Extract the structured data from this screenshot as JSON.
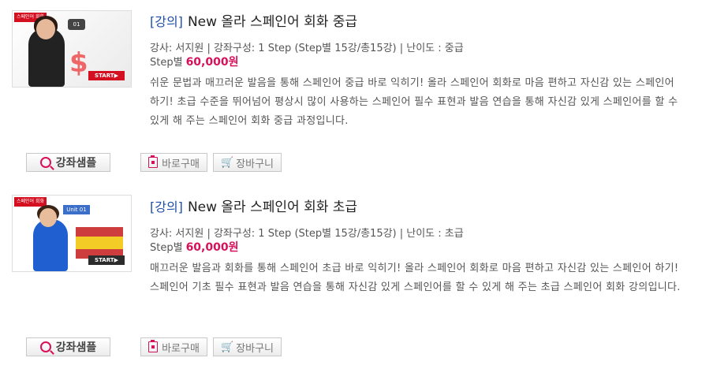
{
  "courses": [
    {
      "category": "[강의]",
      "title": "New 올라 스페인어 회화 중급",
      "meta": "강사: 서지원 | 강좌구성: 1 Step (Step별 15강/총15강) | 난이도 : 중급",
      "price_label": "Step별",
      "price": "60,000원",
      "description": "쉬운 문법과 매끄러운 발음을 통해 스페인어 중급 바로 익히기! 올라 스페인어 회화로 마음 편하고 자신감 있는 스페인어 하기! 초급 수준을 뛰어넘어 평상시 많이 사용하는 스페인어 필수 표현과 발음 연습을 통해 자신감 있게 스페인어를 할 수 있게 해 주는 스페인어 회화 중급 과정입니다.",
      "thumb": {
        "logo": "스페인어 회화",
        "unit": "01",
        "start": "START▶"
      }
    },
    {
      "category": "[강의]",
      "title": "New 올라 스페인어 회화 초급",
      "meta": "강사: 서지원 | 강좌구성: 1 Step (Step별 15강/총15강) | 난이도 : 초급",
      "price_label": "Step별",
      "price": "60,000원",
      "description": "매끄러운 발음과 회화를 통해 스페인어 초급 바로 익히기! 올라 스페인어 회화로 마음 편하고 자신감 있는 스페인어 하기! 스페인어 기초 필수 표현과 발음 연습을 통해 자신감 있게 스페인어를 할 수 있게 해 주는 초급 스페인어 회화 강의입니다.",
      "thumb": {
        "logo": "스페인어 회화",
        "unit": "Unit 01",
        "start": "START▶"
      }
    }
  ],
  "buttons": {
    "sample": "강좌샘플",
    "buy": "바로구매",
    "cart": "장바구니"
  },
  "colors": {
    "accent": "#d6115a",
    "category": "#1e4fa8"
  }
}
